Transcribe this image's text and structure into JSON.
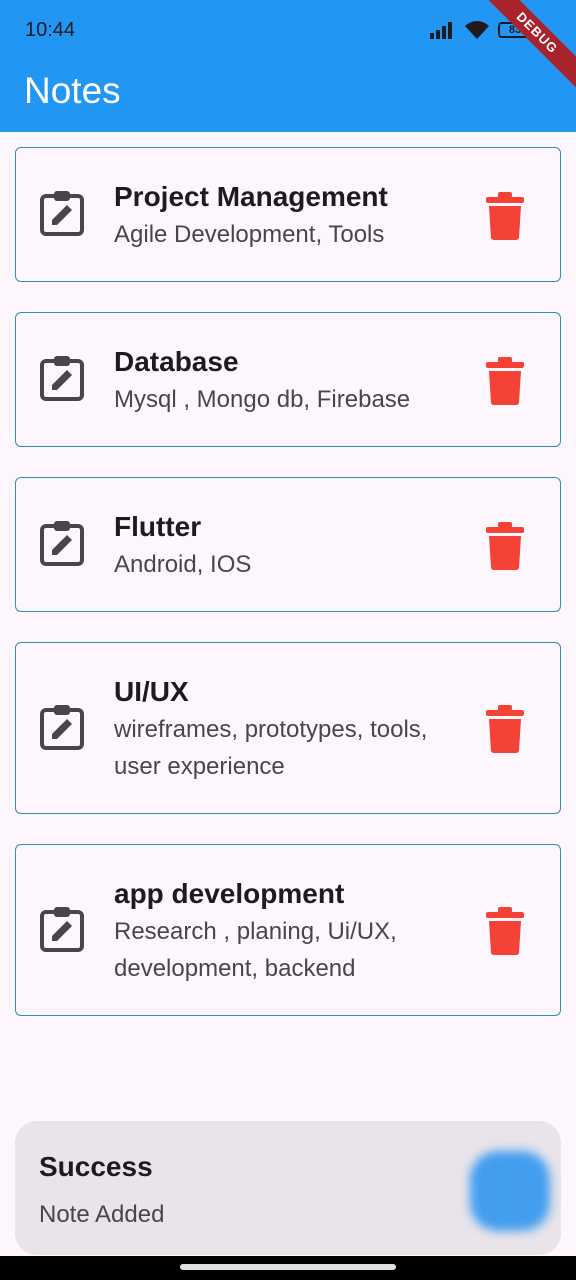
{
  "status_bar": {
    "time": "10:44",
    "battery": "83"
  },
  "debug_banner": "DEBUG",
  "appbar": {
    "title": "Notes"
  },
  "notes": [
    {
      "title": "Project Management",
      "body": "Agile Development, Tools"
    },
    {
      "title": "Database",
      "body": "Mysql , Mongo db, Firebase"
    },
    {
      "title": "Flutter",
      "body": "Android, IOS"
    },
    {
      "title": "UI/UX",
      "body": "wireframes, prototypes, tools, user experience"
    },
    {
      "title": "app development",
      "body": "Research , planing, Ui/UX, development, backend"
    }
  ],
  "snackbar": {
    "title": "Success",
    "message": "Note Added"
  },
  "colors": {
    "appbar": "#2196f3",
    "card_border": "#2b8fbf",
    "delete": "#f44336",
    "background": "#fdf7fd"
  },
  "icons": {
    "note": "clipboard-edit-icon",
    "delete": "trash-icon",
    "signal": "signal-icon",
    "wifi": "wifi-icon",
    "battery": "battery-icon"
  }
}
